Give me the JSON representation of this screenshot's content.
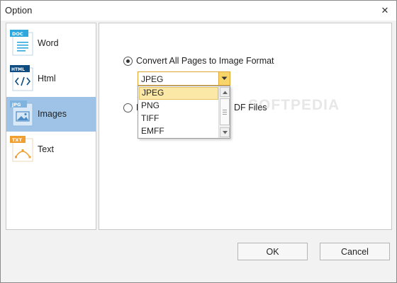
{
  "window": {
    "title": "Option",
    "close_glyph": "✕"
  },
  "sidebar": {
    "items": [
      {
        "label": "Word",
        "badge": "DOC",
        "icon": "word-doc-icon",
        "badge_color": "#2ea8dd",
        "selected": false
      },
      {
        "label": "Html",
        "badge": "HTML",
        "icon": "html-code-icon",
        "badge_color": "#0f4c81",
        "selected": false
      },
      {
        "label": "Images",
        "badge": "JPG",
        "icon": "image-file-icon",
        "badge_color": "#7fb4e0",
        "selected": true
      },
      {
        "label": "Text",
        "badge": "TXT",
        "icon": "text-file-icon",
        "badge_color": "#f0a030",
        "selected": false
      }
    ]
  },
  "panel": {
    "option_convert_label": "Convert All Pages to Image Format",
    "option_extract_label_left": "E",
    "option_extract_label_right": "DF Files",
    "convert_selected": true,
    "format_combo": {
      "value": "JPEG",
      "options": [
        "JPEG",
        "PNG",
        "TIFF",
        "EMFF"
      ],
      "highlighted": "JPEG"
    },
    "watermark": "SOFTPEDIA"
  },
  "footer": {
    "ok_label": "OK",
    "cancel_label": "Cancel"
  },
  "colors": {
    "selected_nav": "#9ec3e6",
    "combo_accent": "#e0a534",
    "highlight": "#fbe8a6"
  }
}
